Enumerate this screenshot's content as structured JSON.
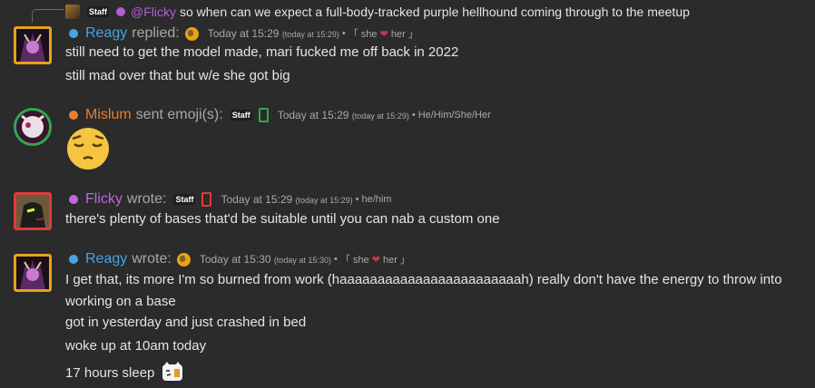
{
  "reply_preview": {
    "badge": "Staff",
    "mention": "@Flicky",
    "text": "so when can we expect a full-body-tracked purple hellhound coming through to the meetup"
  },
  "messages": [
    {
      "user": "Reagy",
      "user_color": "#4aa3e0",
      "verb": "replied:",
      "timestamp": "Today at 15:29",
      "timestamp_small": "(today at 15:29)",
      "separator": "•",
      "pronouns_pre": "「 she",
      "pronouns_post": "her 」",
      "heart": "❤",
      "lines": [
        "still need to get the model made, mari fucked me off back in 2022",
        "still mad over that but w/e she got big"
      ]
    },
    {
      "user": "Mislum",
      "user_color": "#e97e2e",
      "verb": "sent emoji(s):",
      "badge": "Staff",
      "timestamp": "Today at 15:29",
      "timestamp_small": "(today at 15:29)",
      "separator": "•",
      "pronouns": "He/Him/She/Her",
      "emoji": "pensive-emoji"
    },
    {
      "user": "Flicky",
      "user_color": "#c465e0",
      "verb": "wrote:",
      "badge": "Staff",
      "timestamp": "Today at 15:29",
      "timestamp_small": "(today at 15:29)",
      "separator": "•",
      "pronouns": "he/him",
      "lines": [
        "there's plenty of bases that'd be suitable until you can nab a custom one"
      ]
    },
    {
      "user": "Reagy",
      "user_color": "#4aa3e0",
      "verb": "wrote:",
      "timestamp": "Today at 15:30",
      "timestamp_small": "(today at 15:30)",
      "separator": "•",
      "pronouns_pre": "「 she",
      "pronouns_post": "her 」",
      "heart": "❤",
      "lines": [
        "I get that, its more I'm so burned from work (haaaaaaaaaaaaaaaaaaaaaaaah) really don't have the energy to throw into working on a base",
        "got in yesterday and just crashed in bed",
        "woke up at 10am today",
        "17 hours sleep"
      ]
    }
  ]
}
